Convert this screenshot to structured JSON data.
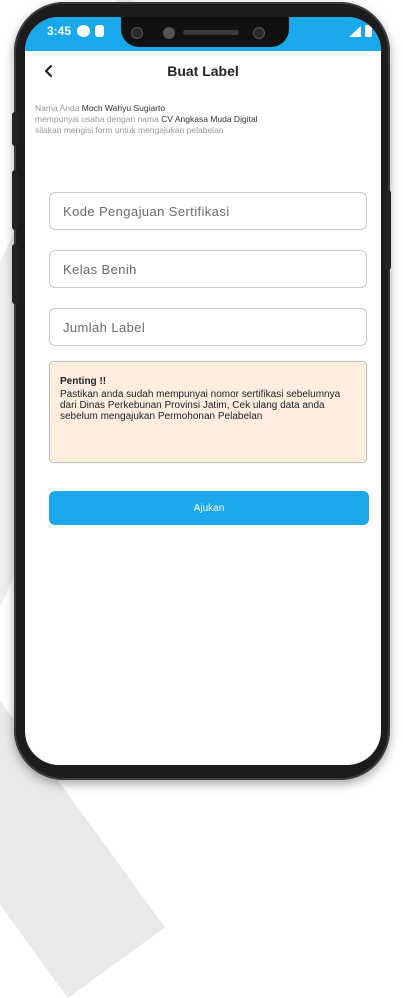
{
  "status_bar": {
    "time": "3:45"
  },
  "app_bar": {
    "title": "Buat Label"
  },
  "intro": {
    "prefix1": "Nama Anda ",
    "name": "Moch Wahyu Sugiarto",
    "prefix2": "mempunyai usaha dengan nama ",
    "company": "CV Angkasa Muda Digital",
    "line3": "silakan mengisi form untuk mengajukan pelabelan"
  },
  "form": {
    "kode_placeholder": "Kode Pengajuan Sertifikasi",
    "kelas_placeholder": "Kelas Benih",
    "jumlah_placeholder": "Jumlah Label"
  },
  "notice": {
    "title": "Penting !!",
    "body": "Pastikan anda sudah mempunyai nomor sertifikasi sebelumnya dari Dinas Perkebunan Provinsi Jatim, Cek ulang data anda sebelum mengajukan Permohonan Pelabelan"
  },
  "submit_label": "Ajukan",
  "colors": {
    "accent": "#1aa8ec",
    "notice_bg": "#fdeee0",
    "phone_frame": "#1c1c1c"
  }
}
